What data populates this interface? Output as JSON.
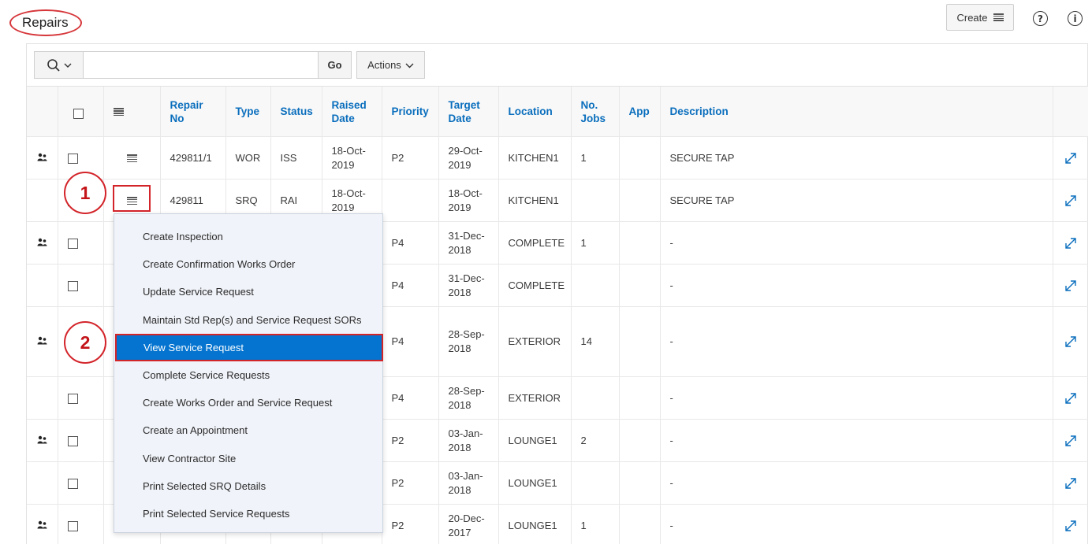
{
  "page": {
    "title": "Repairs"
  },
  "header": {
    "create_label": "Create",
    "help_icon": "?",
    "info_icon": "i"
  },
  "toolbar": {
    "search_placeholder": "",
    "go_label": "Go",
    "actions_label": "Actions"
  },
  "table": {
    "columns": [
      "Repair No",
      "Type",
      "Status",
      "Raised Date",
      "Priority",
      "Target Date",
      "Location",
      "No. Jobs",
      "App",
      "Description"
    ],
    "rows": [
      {
        "person": true,
        "repair_no": "429811/1",
        "type": "WOR",
        "status": "ISS",
        "raised": "18-Oct-2019",
        "priority": "P2",
        "target": "29-Oct-2019",
        "location": "KITCHEN1",
        "jobs": "1",
        "app": "",
        "description": "SECURE TAP"
      },
      {
        "person": false,
        "repair_no": "429811",
        "type": "SRQ",
        "status": "RAI",
        "raised": "18-Oct-2019",
        "priority": "",
        "target": "18-Oct-2019",
        "location": "KITCHEN1",
        "jobs": "",
        "app": "",
        "description": "SECURE TAP"
      },
      {
        "person": true,
        "repair_no": "",
        "type": "",
        "status": "",
        "raised": "",
        "priority": "P4",
        "target": "31-Dec-2018",
        "location": "COMPLETE",
        "jobs": "1",
        "app": "",
        "description": "-"
      },
      {
        "person": false,
        "repair_no": "",
        "type": "",
        "status": "",
        "raised": "",
        "priority": "P4",
        "target": "31-Dec-2018",
        "location": "COMPLETE",
        "jobs": "",
        "app": "",
        "description": "-"
      },
      {
        "person": true,
        "repair_no": "",
        "type": "",
        "status": "",
        "raised": "",
        "priority": "P4",
        "target": "28-Sep-2018",
        "location": "EXTERIOR",
        "jobs": "14",
        "app": "",
        "description": "-"
      },
      {
        "person": false,
        "repair_no": "",
        "type": "",
        "status": "",
        "raised": "",
        "priority": "P4",
        "target": "28-Sep-2018",
        "location": "EXTERIOR",
        "jobs": "",
        "app": "",
        "description": "-"
      },
      {
        "person": true,
        "repair_no": "",
        "type": "",
        "status": "",
        "raised": "",
        "priority": "P2",
        "target": "03-Jan-2018",
        "location": "LOUNGE1",
        "jobs": "2",
        "app": "",
        "description": "-"
      },
      {
        "person": false,
        "repair_no": "",
        "type": "",
        "status": "",
        "raised": "",
        "priority": "P2",
        "target": "03-Jan-2018",
        "location": "LOUNGE1",
        "jobs": "",
        "app": "",
        "description": "-"
      },
      {
        "person": true,
        "repair_no": "",
        "type": "",
        "status": "",
        "raised": "",
        "priority": "P2",
        "target": "20-Dec-2017",
        "location": "LOUNGE1",
        "jobs": "1",
        "app": "",
        "description": "-"
      }
    ]
  },
  "row_menu": {
    "items": [
      "Create Inspection",
      "Create Confirmation Works Order",
      "Update Service Request",
      "Maintain Std Rep(s) and Service Request SORs",
      "View Service Request",
      "Complete Service Requests",
      "Create Works Order and Service Request",
      "Create an Appointment",
      "View Contractor Site",
      "Print Selected SRQ Details",
      "Print Selected Service Requests"
    ],
    "active_item": "View Service Request"
  },
  "callouts": [
    "1",
    "2"
  ],
  "colors": {
    "link": "#0a6ebd",
    "active": "#0474d0",
    "callout": "#d3242a"
  }
}
